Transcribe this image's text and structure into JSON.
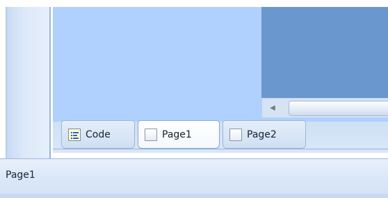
{
  "tabs": [
    {
      "label": "Code",
      "icon": "code-file-icon"
    },
    {
      "label": "Page1",
      "icon": "page-icon",
      "active": true
    },
    {
      "label": "Page2",
      "icon": "page-icon"
    }
  ],
  "status_bar": {
    "text": "Page1"
  },
  "scrollbar": {
    "left_arrow": "◀"
  },
  "colors": {
    "design_surface": "#b0d0fe",
    "dark_panel": "#6b97cf",
    "status_bar": "#dce8f8"
  }
}
